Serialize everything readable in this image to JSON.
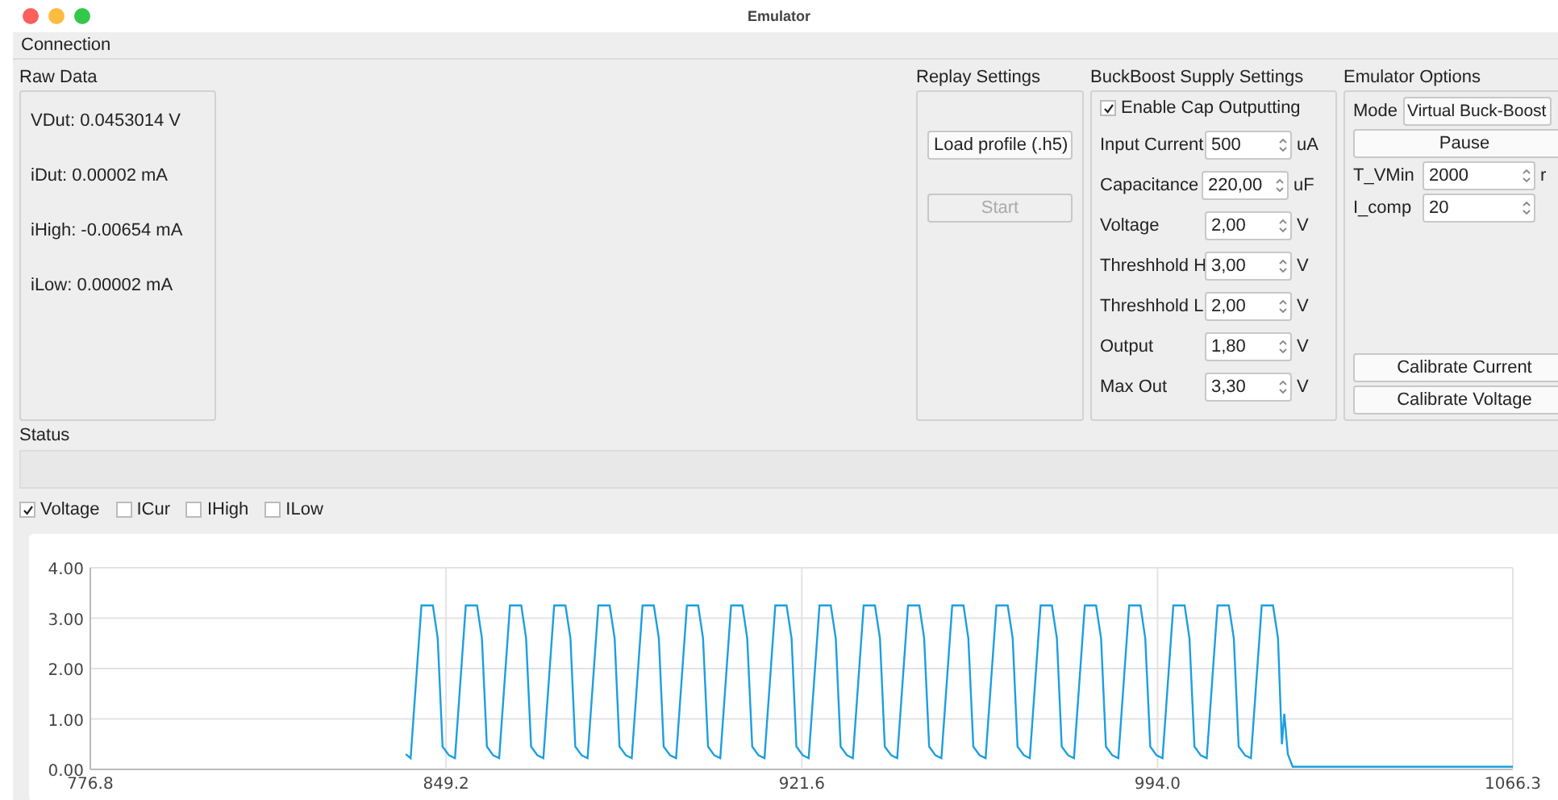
{
  "window": {
    "title": "Emulator"
  },
  "menu": [
    "Connection"
  ],
  "raw_data": {
    "title": "Raw Data",
    "lines": [
      "VDut: 0.0453014 V",
      "iDut: 0.00002 mA",
      "iHigh: -0.00654 mA",
      "iLow: 0.00002 mA"
    ]
  },
  "replay": {
    "title": "Replay Settings",
    "buttons": [
      {
        "label": "Load profile (.h5)",
        "disabled": false
      },
      {
        "label": "Start",
        "disabled": true
      }
    ]
  },
  "buckboost": {
    "title": "BuckBoost Supply Settings",
    "enable": {
      "label": "Enable Cap Outputting",
      "checked": true
    },
    "fields": [
      {
        "label": "Input Current",
        "value": "500",
        "unit": "uA"
      },
      {
        "label": "Capacitance",
        "value": "220,00",
        "unit": "uF"
      },
      {
        "label": "Voltage",
        "value": "2,00",
        "unit": "V"
      },
      {
        "label": "Threshhold H",
        "value": "3,00",
        "unit": "V"
      },
      {
        "label": "Threshhold L",
        "value": "2,00",
        "unit": "V"
      },
      {
        "label": "Output",
        "value": "1,80",
        "unit": "V"
      },
      {
        "label": "Max Out",
        "value": "3,30",
        "unit": "V"
      }
    ]
  },
  "emulator": {
    "title": "Emulator Options",
    "mode": {
      "label": "Mode",
      "value": "Virtual Buck-Boost"
    },
    "pause": "Pause",
    "fields": [
      {
        "label": "T_VMin",
        "value": "2000",
        "unit": "r"
      },
      {
        "label": "I_comp",
        "value": "20"
      }
    ],
    "buttons": [
      "Calibrate Current",
      "Calibrate Voltage"
    ]
  },
  "status": {
    "title": "Status"
  },
  "channels": [
    {
      "label": "Voltage",
      "checked": true
    },
    {
      "label": "ICur",
      "checked": false
    },
    {
      "label": "IHigh",
      "checked": false
    },
    {
      "label": "ILow",
      "checked": false
    }
  ],
  "chart": {
    "chart_data": {
      "type": "line",
      "grid": true,
      "xlim": [
        776.8,
        1066.3
      ],
      "ylim": [
        0,
        4
      ],
      "xticks": [
        {
          "value": 776.8,
          "label": "776.8"
        },
        {
          "value": 849.2,
          "label": "849.2"
        },
        {
          "value": 921.6,
          "label": "921.6"
        },
        {
          "value": 994,
          "label": "994.0"
        },
        {
          "value": 1066.3,
          "label": "1066.3"
        }
      ],
      "yticks": [
        {
          "value": 0,
          "label": "0.00"
        },
        {
          "value": 1,
          "label": "1.00"
        },
        {
          "value": 2,
          "label": "2.00"
        },
        {
          "value": 3,
          "label": "3.00"
        },
        {
          "value": 4,
          "label": "4.00"
        }
      ],
      "x": [
        841,
        842,
        844.2,
        846.5,
        847.5,
        848.5,
        849.8,
        851,
        853.2,
        855.5,
        856.5,
        857.5,
        858.8,
        860,
        862.2,
        864.5,
        865.5,
        866.5,
        867.8,
        869,
        871.2,
        873.5,
        874.5,
        875.5,
        876.8,
        878,
        880.2,
        882.5,
        883.5,
        884.5,
        885.8,
        887,
        889.2,
        891.5,
        892.5,
        893.5,
        894.8,
        896,
        898.2,
        900.5,
        901.5,
        902.5,
        903.8,
        905,
        907.2,
        909.5,
        910.5,
        911.5,
        912.8,
        914,
        916.2,
        918.5,
        919.5,
        920.5,
        921.8,
        923,
        925.2,
        927.5,
        928.5,
        929.5,
        930.8,
        932,
        934.2,
        936.5,
        937.5,
        938.5,
        939.8,
        941,
        943.2,
        945.5,
        946.5,
        947.5,
        948.8,
        950,
        952.2,
        954.5,
        955.5,
        956.5,
        957.8,
        959,
        961.2,
        963.5,
        964.5,
        965.5,
        966.8,
        968,
        970.2,
        972.5,
        973.5,
        974.5,
        975.8,
        977,
        979.2,
        981.5,
        982.5,
        983.5,
        984.8,
        986,
        988.2,
        990.5,
        991.5,
        992.5,
        993.8,
        995,
        997.2,
        999.5,
        1000.5,
        1001.5,
        1002.8,
        1004,
        1006.2,
        1008.5,
        1009.5,
        1010.5,
        1011.8,
        1013,
        1015.2,
        1017.5,
        1018.5,
        1019.3,
        1019.8,
        1020.5,
        1021.5,
        1066.3
      ],
      "series": [
        {
          "color": "#1b9fe0",
          "values": [
            0.3,
            0.22,
            3.25,
            3.25,
            2.6,
            0.45,
            0.28,
            0.22,
            3.25,
            3.25,
            2.6,
            0.45,
            0.28,
            0.22,
            3.25,
            3.25,
            2.6,
            0.45,
            0.28,
            0.22,
            3.25,
            3.25,
            2.6,
            0.45,
            0.28,
            0.22,
            3.25,
            3.25,
            2.6,
            0.45,
            0.28,
            0.22,
            3.25,
            3.25,
            2.6,
            0.45,
            0.28,
            0.22,
            3.25,
            3.25,
            2.6,
            0.45,
            0.28,
            0.22,
            3.25,
            3.25,
            2.6,
            0.45,
            0.28,
            0.22,
            3.25,
            3.25,
            2.6,
            0.45,
            0.28,
            0.22,
            3.25,
            3.25,
            2.6,
            0.45,
            0.28,
            0.22,
            3.25,
            3.25,
            2.6,
            0.45,
            0.28,
            0.22,
            3.25,
            3.25,
            2.6,
            0.45,
            0.28,
            0.22,
            3.25,
            3.25,
            2.6,
            0.45,
            0.28,
            0.22,
            3.25,
            3.25,
            2.6,
            0.45,
            0.28,
            0.22,
            3.25,
            3.25,
            2.6,
            0.45,
            0.28,
            0.22,
            3.25,
            3.25,
            2.6,
            0.45,
            0.28,
            0.22,
            3.25,
            3.25,
            2.6,
            0.45,
            0.28,
            0.22,
            3.25,
            3.25,
            2.6,
            0.45,
            0.28,
            0.22,
            3.25,
            3.25,
            2.6,
            0.45,
            0.28,
            0.22,
            3.25,
            3.25,
            2.6,
            0.5,
            1.1,
            0.3,
            0.05,
            0.05
          ]
        }
      ]
    }
  }
}
